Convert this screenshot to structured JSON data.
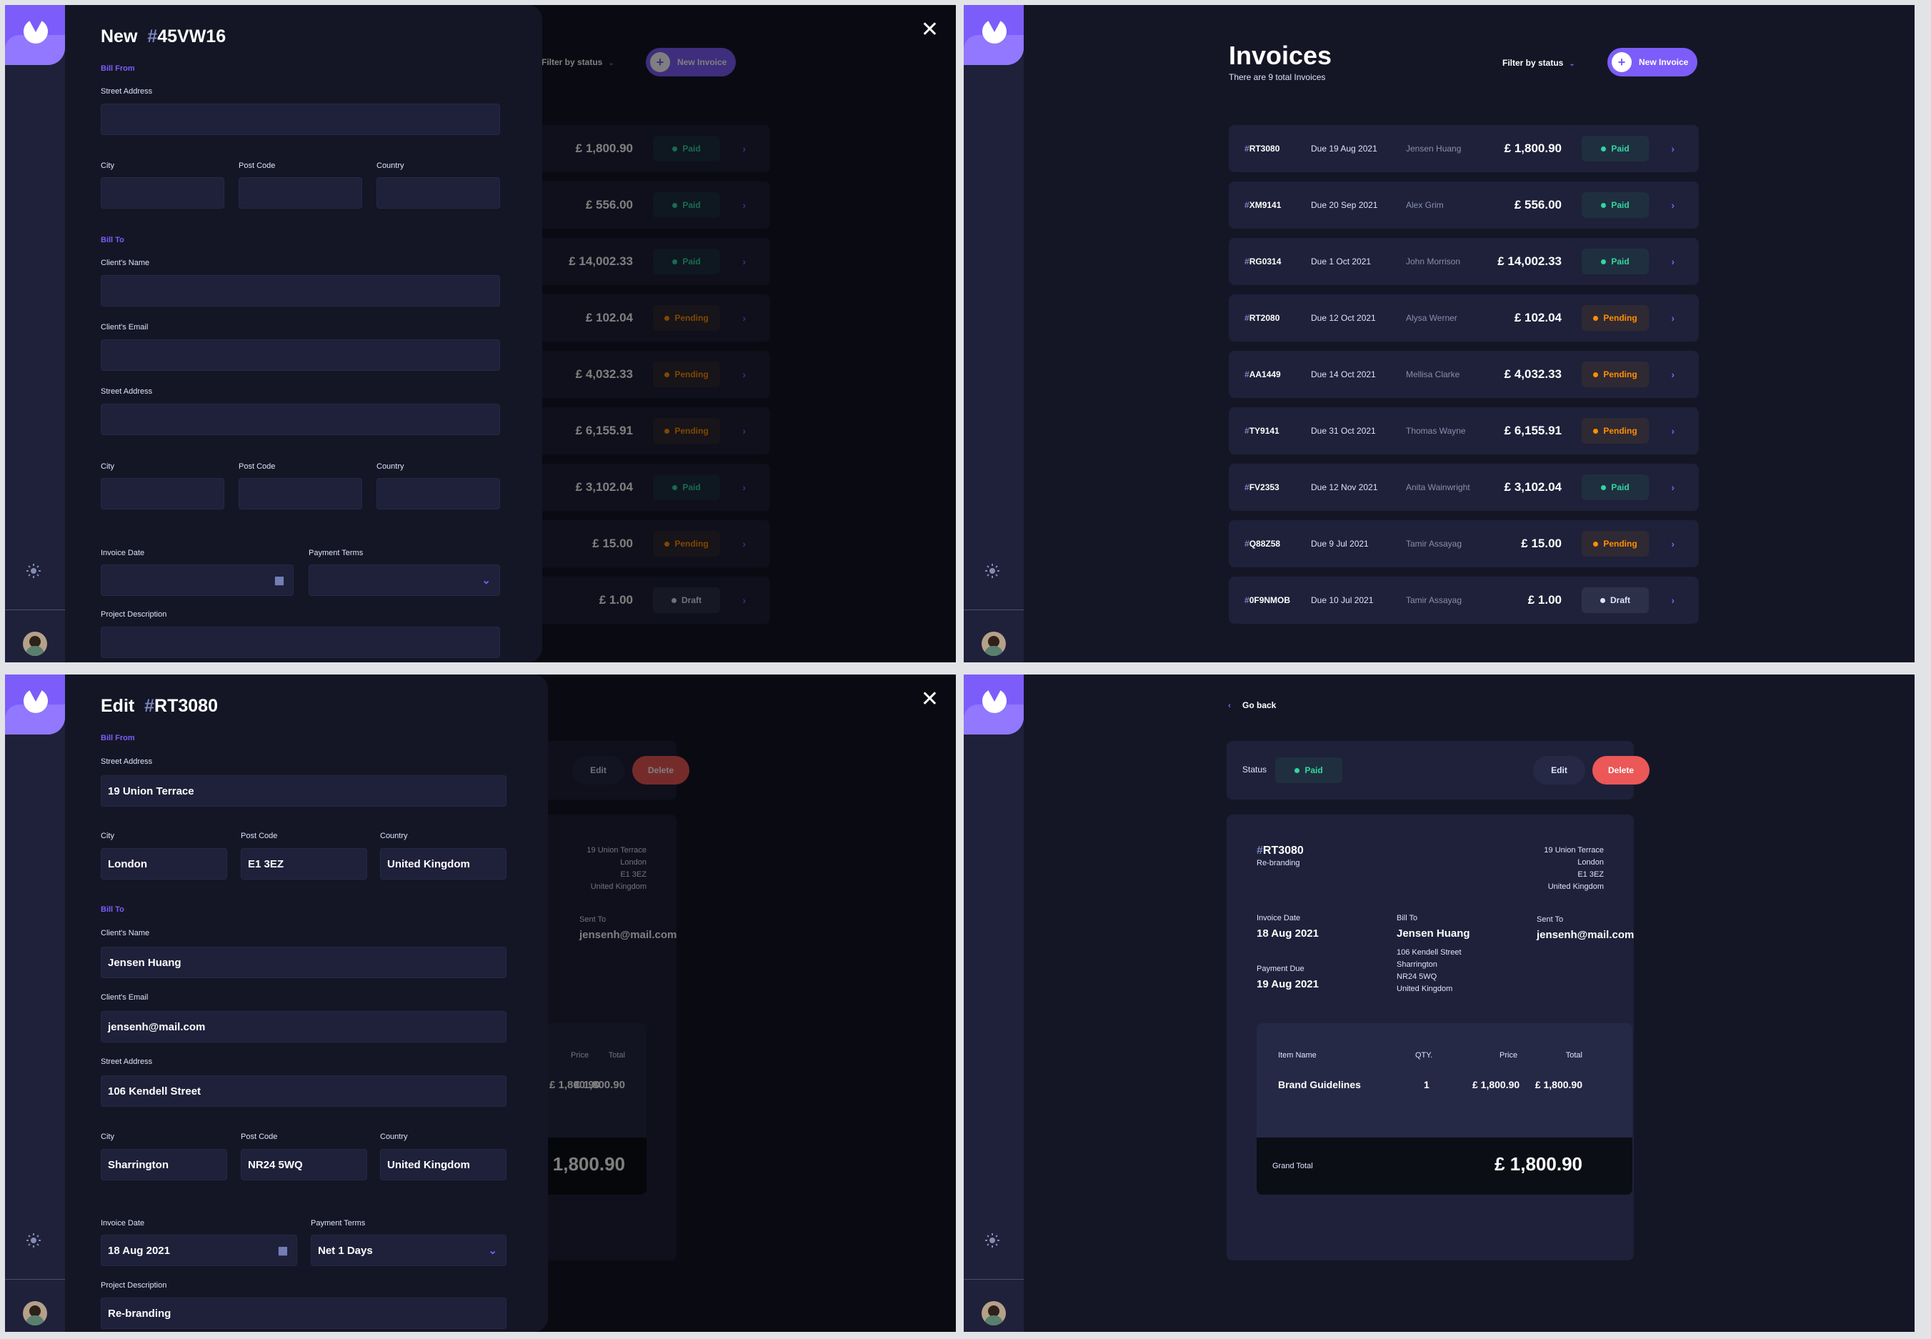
{
  "app": {
    "theme_icon": "sun-icon",
    "logo": "app-logo",
    "avatar": "user-avatar"
  },
  "colors": {
    "accent": "#7c5dfa",
    "paid": "#33d69f",
    "pending": "#ff8f00",
    "draft": "#dfe3fa",
    "danger": "#ec5757",
    "bg": "#141625",
    "surface": "#1e2139"
  },
  "list": {
    "title": "Invoices",
    "subtitle": "There are 9 total Invoices",
    "filter_label": "Filter by status",
    "new_label": "New Invoice",
    "currency": "£",
    "invoices": [
      {
        "id": "RT3080",
        "due": "Due 19 Aug 2021",
        "client": "Jensen Huang",
        "amount": "£ 1,800.90",
        "status": "Paid",
        "status_key": "paid"
      },
      {
        "id": "XM9141",
        "due": "Due 20 Sep 2021",
        "client": "Alex Grim",
        "amount": "£ 556.00",
        "status": "Paid",
        "status_key": "paid"
      },
      {
        "id": "RG0314",
        "due": "Due 1 Oct 2021",
        "client": "John Morrison",
        "amount": "£ 14,002.33",
        "status": "Paid",
        "status_key": "paid"
      },
      {
        "id": "RT2080",
        "due": "Due 12 Oct 2021",
        "client": "Alysa Werner",
        "amount": "£ 102.04",
        "status": "Pending",
        "status_key": "pending"
      },
      {
        "id": "AA1449",
        "due": "Due 14 Oct 2021",
        "client": "Mellisa Clarke",
        "amount": "£ 4,032.33",
        "status": "Pending",
        "status_key": "pending"
      },
      {
        "id": "TY9141",
        "due": "Due 31 Oct 2021",
        "client": "Thomas Wayne",
        "amount": "£ 6,155.91",
        "status": "Pending",
        "status_key": "pending"
      },
      {
        "id": "FV2353",
        "due": "Due 12 Nov 2021",
        "client": "Anita Wainwright",
        "amount": "£ 3,102.04",
        "status": "Paid",
        "status_key": "paid"
      },
      {
        "id": "Q88Z58",
        "due": "Due 9 Jul 2021",
        "client": "Tamir Assayag",
        "amount": "£ 15.00",
        "status": "Pending",
        "status_key": "pending"
      },
      {
        "id": "0F9NMOB",
        "due": "Due 10 Jul 2021",
        "client": "Tamir Assayag",
        "amount": "£ 1.00",
        "status": "Draft",
        "status_key": "draft"
      }
    ]
  },
  "new_form": {
    "heading": "New",
    "hash": "#",
    "id": "45VW16",
    "bill_from": "Bill From",
    "bill_to": "Bill To",
    "labels": {
      "street": "Street Address",
      "city": "City",
      "post": "Post Code",
      "country": "Country",
      "client_name": "Client's Name",
      "client_email": "Client's Email",
      "invoice_date": "Invoice Date",
      "payment_terms": "Payment Terms",
      "project_desc": "Project Description"
    }
  },
  "edit_form": {
    "heading": "Edit",
    "hash": "#",
    "id": "RT3080",
    "bill_from": "Bill From",
    "bill_to": "Bill To",
    "labels": {
      "street": "Street Address",
      "city": "City",
      "post": "Post Code",
      "country": "Country",
      "client_name": "Client's Name",
      "client_email": "Client's Email",
      "invoice_date": "Invoice Date",
      "payment_terms": "Payment Terms",
      "project_desc": "Project Description"
    },
    "values": {
      "from_street": "19 Union Terrace",
      "from_city": "London",
      "from_post": "E1 3EZ",
      "from_country": "United Kingdom",
      "client_name": "Jensen Huang",
      "client_email": "jensenh@mail.com",
      "to_street": "106 Kendell Street",
      "to_city": "Sharrington",
      "to_post": "NR24 5WQ",
      "to_country": "United Kingdom",
      "invoice_date": "18 Aug 2021",
      "payment_terms": "Net 1 Days",
      "project_desc": "Re-branding"
    }
  },
  "detail": {
    "go_back": "Go back",
    "status_label": "Status",
    "status": "Paid",
    "edit": "Edit",
    "delete": "Delete",
    "hash": "#",
    "id": "RT3080",
    "description": "Re-branding",
    "from_address": [
      "19 Union Terrace",
      "London",
      "E1 3EZ",
      "United Kingdom"
    ],
    "invoice_date_label": "Invoice Date",
    "invoice_date": "18 Aug 2021",
    "payment_due_label": "Payment Due",
    "payment_due": "19 Aug 2021",
    "bill_to_label": "Bill To",
    "client_name": "Jensen Huang",
    "client_address": [
      "106 Kendell Street",
      "Sharrington",
      "NR24 5WQ",
      "United Kingdom"
    ],
    "sent_to_label": "Sent To",
    "sent_to": "jensenh@mail.com",
    "items_headers": {
      "name": "Item Name",
      "qty": "QTY.",
      "price": "Price",
      "total": "Total"
    },
    "items": [
      {
        "name": "Brand Guidelines",
        "qty": "1",
        "price": "£ 1,800.90",
        "total": "£ 1,800.90"
      }
    ],
    "grand_total_label": "Grand Total",
    "grand_total": "£ 1,800.90"
  }
}
